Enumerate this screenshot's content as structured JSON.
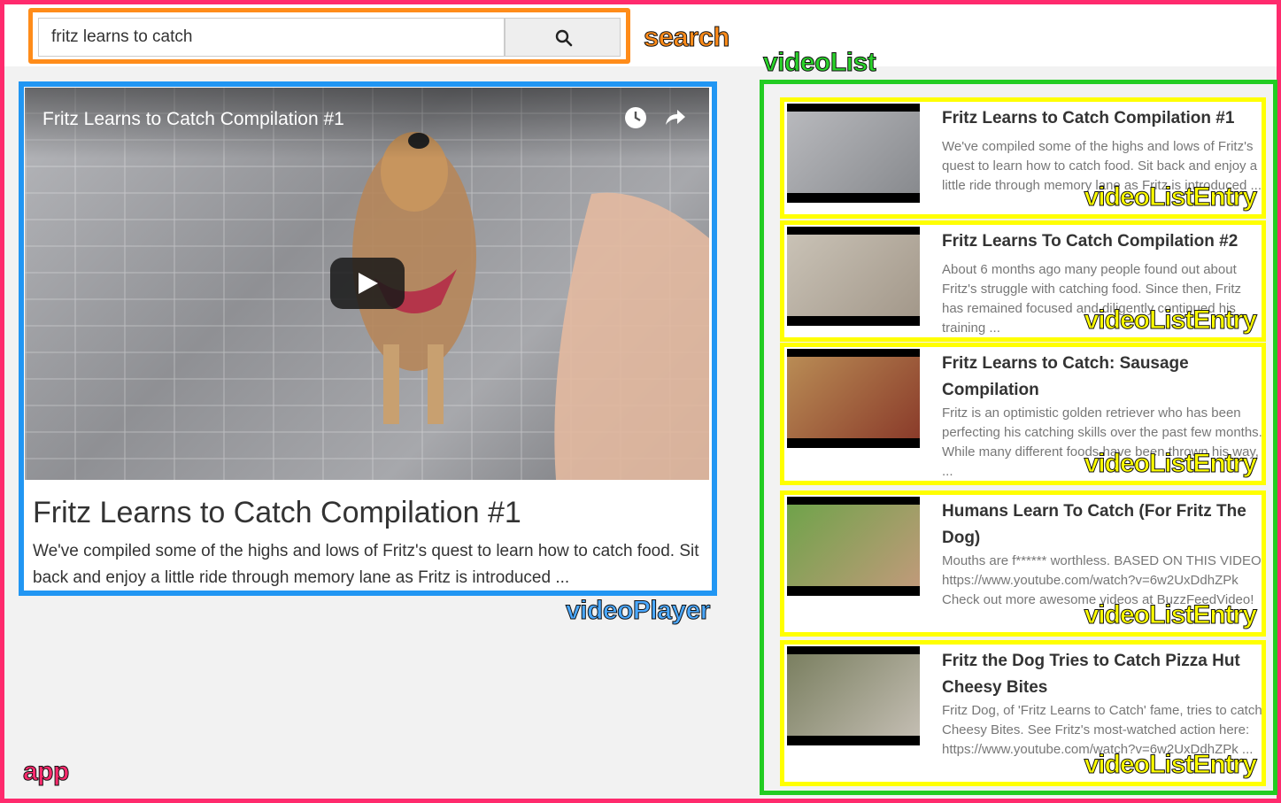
{
  "annotations": {
    "search": "search",
    "videoList": "videoList",
    "videoPlayer": "videoPlayer",
    "app": "app",
    "videoListEntry": "videoListEntry"
  },
  "search": {
    "value": "fritz learns to catch",
    "button_icon": "search-icon"
  },
  "player": {
    "overlay_title": "Fritz Learns to Catch Compilation #1",
    "overlay_icons": [
      "clock-icon",
      "share-icon"
    ],
    "play_icon": "play-icon",
    "title": "Fritz Learns to Catch Compilation #1",
    "description": "We've compiled some of the highs and lows of Fritz's quest to learn how to catch food. Sit back and enjoy a little ride through memory lane as Fritz is introduced ..."
  },
  "videoList": {
    "entries": [
      {
        "title": "Fritz Learns to Catch Compilation #1",
        "description": "We've compiled some of the highs and lows of Fritz's quest to learn how to catch food. Sit back and enjoy a little ride through memory lane as Fritz is introduced ..."
      },
      {
        "title": "Fritz Learns To Catch Compilation #2",
        "description": "About 6 months ago many people found out about Fritz's struggle with catching food. Since then, Fritz has remained focused and diligently continued his training ..."
      },
      {
        "title": "Fritz Learns to Catch: Sausage Compilation",
        "description": "Fritz is an optimistic golden retriever who has been perfecting his catching skills over the past few months. While many different foods have been thrown his way, ..."
      },
      {
        "title": "Humans Learn To Catch (For Fritz The Dog)",
        "description": "Mouths are f****** worthless. BASED ON THIS VIDEO: https://www.youtube.com/watch?v=6w2UxDdhZPk Check out more awesome videos at BuzzFeedVideo!"
      },
      {
        "title": "Fritz the Dog Tries to Catch Pizza Hut Cheesy Bites",
        "description": "Fritz Dog, of 'Fritz Learns to Catch' fame, tries to catch Cheesy Bites. See Fritz's most-watched action here: https://www.youtube.com/watch?v=6w2UxDdhZPk ..."
      }
    ]
  },
  "colors": {
    "app": "#ff2a6d",
    "search": "#ff8c1a",
    "videoPlayer": "#2196f3",
    "videoList": "#22cc22",
    "videoListEntry": "#ffff00"
  }
}
